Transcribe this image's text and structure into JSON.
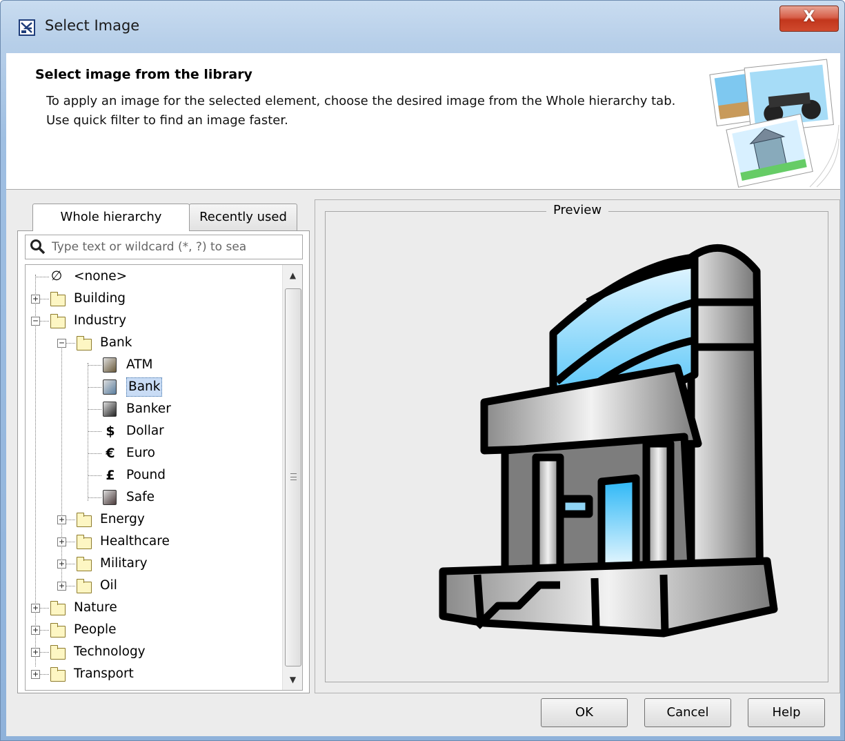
{
  "window": {
    "title": "Select Image",
    "close_glyph": "X"
  },
  "header": {
    "title": "Select image from the library",
    "description": "To apply an image for the selected element, choose the desired image from the Whole hierarchy tab. Use quick filter to find an image faster."
  },
  "tabs": [
    {
      "label": "Whole hierarchy",
      "active": true
    },
    {
      "label": "Recently used",
      "active": false
    }
  ],
  "search": {
    "placeholder": "Type text or wildcard (*, ?) to sea"
  },
  "tree": [
    {
      "label": "<none>",
      "icon": "none-icon",
      "expander": ""
    },
    {
      "label": "Building",
      "icon": "folder-icon",
      "expander": "+"
    },
    {
      "label": "Industry",
      "icon": "folder-icon",
      "expander": "-"
    },
    {
      "label": "Bank",
      "icon": "folder-icon",
      "expander": "-"
    },
    {
      "label": "ATM",
      "icon": "atm-icon"
    },
    {
      "label": "Bank",
      "icon": "bank-icon",
      "selected": true
    },
    {
      "label": "Banker",
      "icon": "banker-icon"
    },
    {
      "label": "Dollar",
      "icon": "dollar-icon",
      "glyph": "$"
    },
    {
      "label": "Euro",
      "icon": "euro-icon",
      "glyph": "€"
    },
    {
      "label": "Pound",
      "icon": "pound-icon",
      "glyph": "£"
    },
    {
      "label": "Safe",
      "icon": "safe-icon"
    },
    {
      "label": "Energy",
      "icon": "folder-icon",
      "expander": "+"
    },
    {
      "label": "Healthcare",
      "icon": "folder-icon",
      "expander": "+"
    },
    {
      "label": "Military",
      "icon": "folder-icon",
      "expander": "+"
    },
    {
      "label": "Oil",
      "icon": "folder-icon",
      "expander": "+"
    },
    {
      "label": "Nature",
      "icon": "folder-icon",
      "expander": "+"
    },
    {
      "label": "People",
      "icon": "folder-icon",
      "expander": "+"
    },
    {
      "label": "Technology",
      "icon": "folder-icon",
      "expander": "+"
    },
    {
      "label": "Transport",
      "icon": "folder-icon",
      "expander": "+"
    }
  ],
  "preview": {
    "label": "Preview"
  },
  "buttons": {
    "ok": "OK",
    "cancel": "Cancel",
    "help": "Help"
  },
  "colors": {
    "accent": "#3b6ea5",
    "selection": "#c9dcf5",
    "preview_glass": "#29b6f6"
  }
}
